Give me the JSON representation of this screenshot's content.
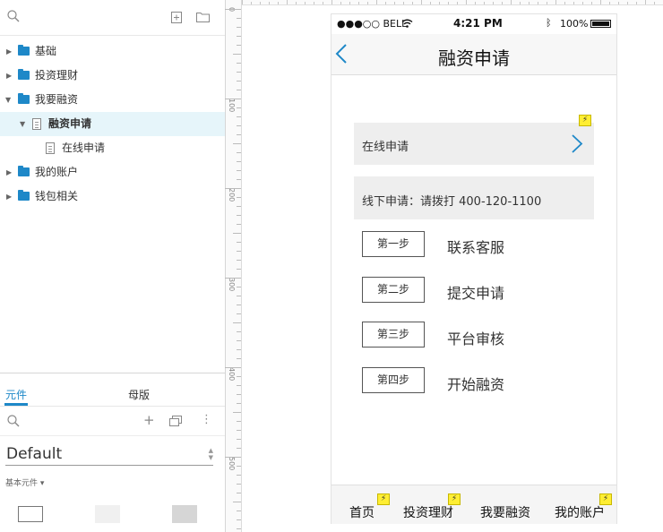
{
  "outline": {
    "items": [
      {
        "label": "基础"
      },
      {
        "label": "投资理财"
      },
      {
        "label": "我要融资"
      },
      {
        "label": "融资申请"
      },
      {
        "label": "在线申请"
      },
      {
        "label": "我的账户"
      },
      {
        "label": "钱包相关"
      }
    ]
  },
  "library": {
    "tabs": [
      {
        "label": "元件"
      },
      {
        "label": "母版"
      }
    ],
    "selected": "Default",
    "category": "基本元件 ▾"
  },
  "ruler": {
    "labels": [
      "0",
      "100",
      "200",
      "300",
      "400",
      "500"
    ]
  },
  "phone": {
    "carrier": "●●●○○ BELL",
    "time": "4:21 PM",
    "battery": "100%",
    "title": "融资申请",
    "online_apply": "在线申请",
    "offline_apply": "线下申请：请拨打 400-120-1100",
    "steps": [
      {
        "button": "第一步",
        "text": "联系客服"
      },
      {
        "button": "第二步",
        "text": "提交申请"
      },
      {
        "button": "第三步",
        "text": "平台审核"
      },
      {
        "button": "第四步",
        "text": "开始融资"
      }
    ],
    "tabs": [
      {
        "label": "首页"
      },
      {
        "label": "投资理财"
      },
      {
        "label": "我要融资"
      },
      {
        "label": "我的账户"
      }
    ]
  },
  "colors": {
    "folder": "#1e88c8",
    "accent": "#1e88c8",
    "selection": "#e6f5fa",
    "bolt": "#ffee33"
  }
}
